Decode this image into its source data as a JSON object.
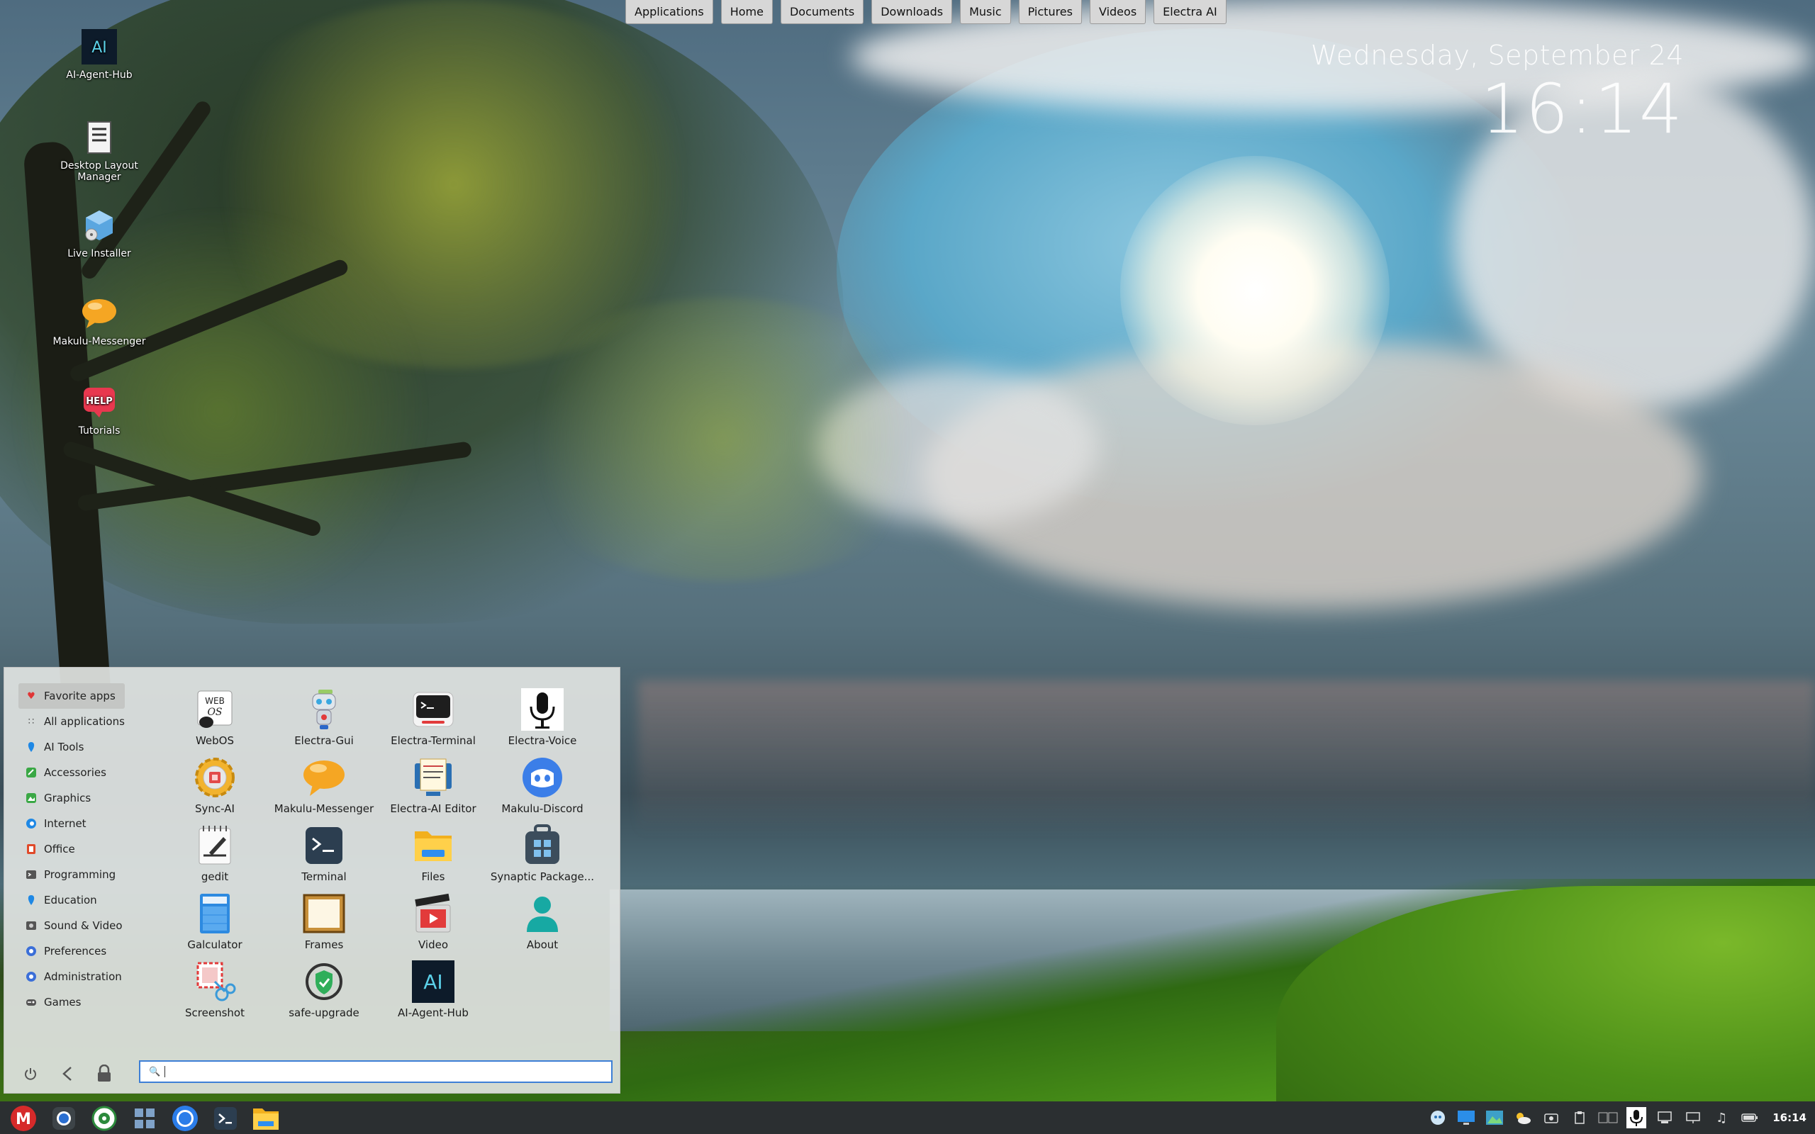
{
  "top_bar": {
    "buttons": [
      "Applications",
      "Home",
      "Documents",
      "Downloads",
      "Music",
      "Pictures",
      "Videos",
      "Electra AI"
    ]
  },
  "clock": {
    "date": "Wednesday, September 24",
    "time": "16:14"
  },
  "desktop_icons": [
    {
      "label": "AI-Agent-Hub",
      "icon": "ai-agent-hub-icon"
    },
    {
      "label": "Desktop Layout Manager",
      "icon": "layout-manager-icon"
    },
    {
      "label": "Live Installer",
      "icon": "installer-icon"
    },
    {
      "label": "Makulu-Messenger",
      "icon": "messenger-icon"
    },
    {
      "label": "Tutorials",
      "icon": "help-icon",
      "badge": "HELP"
    }
  ],
  "menu": {
    "categories": [
      {
        "label": "Favorite apps",
        "icon": "heart-icon",
        "color": "#e03535"
      },
      {
        "label": "All applications",
        "icon": "grid-icon",
        "color": "#555555"
      },
      {
        "label": "AI Tools",
        "icon": "ai-tools-icon",
        "color": "#1e88e5"
      },
      {
        "label": "Accessories",
        "icon": "accessories-icon",
        "color": "#3aa845"
      },
      {
        "label": "Graphics",
        "icon": "graphics-icon",
        "color": "#3aa845"
      },
      {
        "label": "Internet",
        "icon": "internet-icon",
        "color": "#1e88e5"
      },
      {
        "label": "Office",
        "icon": "office-icon",
        "color": "#e04a2a"
      },
      {
        "label": "Programming",
        "icon": "programming-icon",
        "color": "#555555"
      },
      {
        "label": "Education",
        "icon": "education-icon",
        "color": "#1e88e5"
      },
      {
        "label": "Sound & Video",
        "icon": "sound-video-icon",
        "color": "#555555"
      },
      {
        "label": "Preferences",
        "icon": "preferences-icon",
        "color": "#3b6fd8"
      },
      {
        "label": "Administration",
        "icon": "administration-icon",
        "color": "#3b6fd8"
      },
      {
        "label": "Games",
        "icon": "games-icon",
        "color": "#555555"
      }
    ],
    "apps": [
      {
        "label": "WebOS",
        "icon": "webos-icon"
      },
      {
        "label": "Electra-Gui",
        "icon": "robot-icon"
      },
      {
        "label": "Electra-Terminal",
        "icon": "terminal-icon"
      },
      {
        "label": "Electra-Voice",
        "icon": "microphone-icon"
      },
      {
        "label": "Sync-AI",
        "icon": "sync-gear-icon"
      },
      {
        "label": "Makulu-Messenger",
        "icon": "messenger-icon"
      },
      {
        "label": "Electra-AI Editor",
        "icon": "editor-icon"
      },
      {
        "label": "Makulu-Discord",
        "icon": "discord-icon"
      },
      {
        "label": "gedit",
        "icon": "gedit-icon"
      },
      {
        "label": "Terminal",
        "icon": "terminal-icon"
      },
      {
        "label": "Files",
        "icon": "folder-icon"
      },
      {
        "label": "Synaptic Package...",
        "icon": "package-icon"
      },
      {
        "label": "Galculator",
        "icon": "calculator-icon"
      },
      {
        "label": "Frames",
        "icon": "frames-icon"
      },
      {
        "label": "Video",
        "icon": "video-icon"
      },
      {
        "label": "About",
        "icon": "about-icon"
      },
      {
        "label": "Screenshot",
        "icon": "screenshot-icon"
      },
      {
        "label": "safe-upgrade",
        "icon": "shield-icon"
      },
      {
        "label": "AI-Agent-Hub",
        "icon": "ai-agent-hub-icon"
      }
    ],
    "search": {
      "value": "",
      "placeholder": ""
    },
    "bottom_buttons": [
      "power-icon",
      "back-icon",
      "lock-icon"
    ]
  },
  "taskbar": {
    "pinned": [
      "makulu-menu-icon",
      "search-app-icon",
      "settings-app-icon",
      "grid-app-icon",
      "browser-icon",
      "terminal-icon",
      "files-icon"
    ],
    "clock": "16:14",
    "tray": [
      "ai-tray-icon",
      "display-icon",
      "image-icon",
      "weather-icon",
      "camera-icon",
      "clipboard-icon",
      "keyboard-icon",
      "voice-icon",
      "network-icon",
      "monitor-icon",
      "music-icon",
      "battery-icon"
    ]
  },
  "colors": {
    "accent": "#3d7fd6",
    "taskbar": "#2b2f31",
    "menu_bg": "#e1e4e2"
  }
}
